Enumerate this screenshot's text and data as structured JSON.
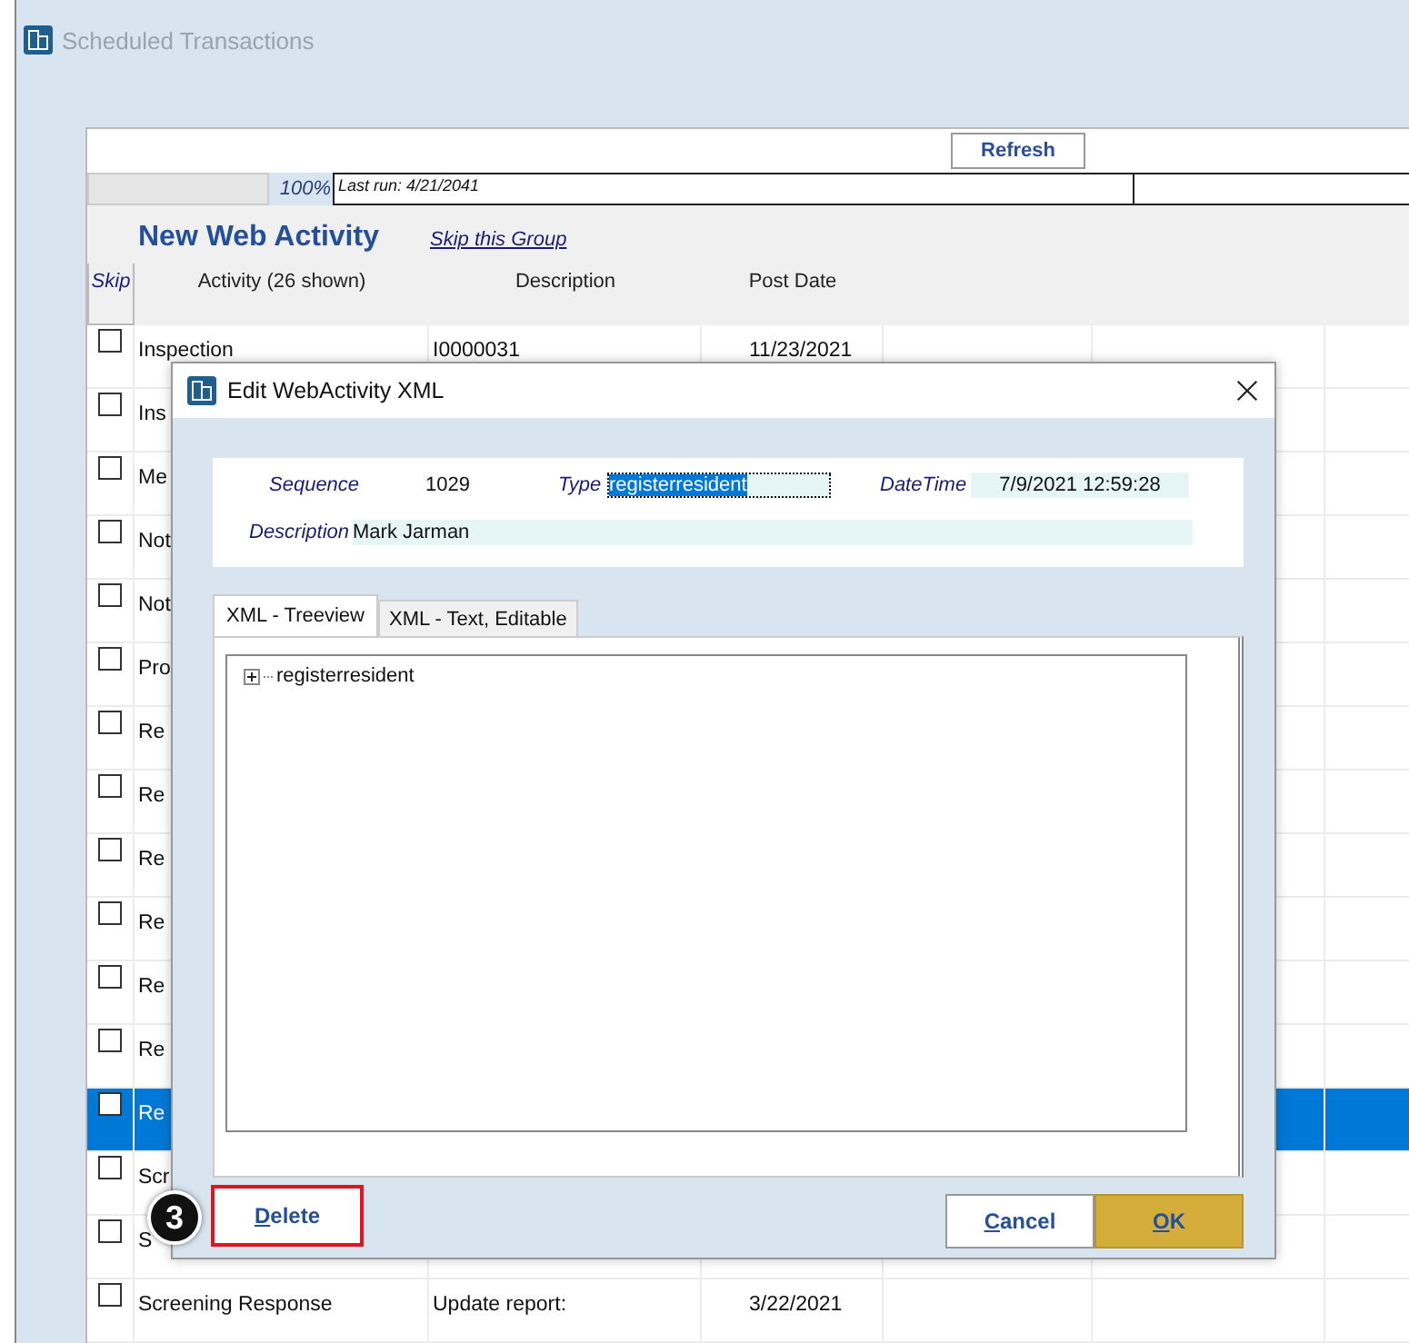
{
  "window": {
    "title": "Scheduled Transactions"
  },
  "toolbar": {
    "refresh": "Refresh",
    "progress": {
      "level": 1,
      "label": "100%"
    },
    "last_run": "Last run: 4/21/2041"
  },
  "group": {
    "title": "New Web Activity",
    "skip_link": "Skip this Group"
  },
  "table": {
    "columns": [
      "Skip",
      "Activity (26 shown)",
      "Description",
      "Post Date"
    ],
    "rows": [
      {
        "checked": false,
        "selected": false,
        "activity": "Inspection",
        "description": "I0000031",
        "post_date": "11/23/2021"
      },
      {
        "checked": false,
        "selected": false,
        "activity": "Ins"
      },
      {
        "checked": false,
        "selected": false,
        "activity": "Me"
      },
      {
        "checked": false,
        "selected": false,
        "activity": "Not"
      },
      {
        "checked": false,
        "selected": false,
        "activity": "Not"
      },
      {
        "checked": false,
        "selected": false,
        "activity": "Pro"
      },
      {
        "checked": false,
        "selected": false,
        "activity": "Re"
      },
      {
        "checked": false,
        "selected": false,
        "activity": "Re"
      },
      {
        "checked": false,
        "selected": false,
        "activity": "Re"
      },
      {
        "checked": false,
        "selected": false,
        "activity": "Re"
      },
      {
        "checked": false,
        "selected": false,
        "activity": "Re"
      },
      {
        "checked": false,
        "selected": false,
        "activity": "Re"
      },
      {
        "checked": false,
        "selected": true,
        "activity": "Re"
      },
      {
        "checked": false,
        "selected": false,
        "activity": "Scr"
      },
      {
        "checked": false,
        "selected": false,
        "activity": "S"
      },
      {
        "checked": false,
        "selected": false,
        "activity": "Screening Response",
        "description": "Update report:",
        "post_date": "3/22/2021"
      }
    ]
  },
  "dialog": {
    "title": "Edit WebActivity XML",
    "sequence": {
      "label": "Sequence",
      "value": "1029"
    },
    "type": {
      "label": "Type",
      "value": "registerresident",
      "focused": true
    },
    "datetime": {
      "label": "DateTime",
      "value": "7/9/2021 12:59:28"
    },
    "description": {
      "label": "Description",
      "value": "Mark Jarman"
    },
    "tabs": [
      {
        "label": "XML - Treeview",
        "selected": true
      },
      {
        "label": "XML - Text, Editable",
        "selected": false
      }
    ],
    "tree": [
      {
        "label": "registerresident",
        "expanded": false
      }
    ],
    "buttons": [
      {
        "label": "Delete",
        "kind": "delete",
        "highlighted": true
      },
      {
        "label": "Cancel",
        "kind": "cancel",
        "highlighted": false
      },
      {
        "label": "OK",
        "kind": "ok",
        "highlighted": false
      }
    ],
    "callout": "3"
  }
}
